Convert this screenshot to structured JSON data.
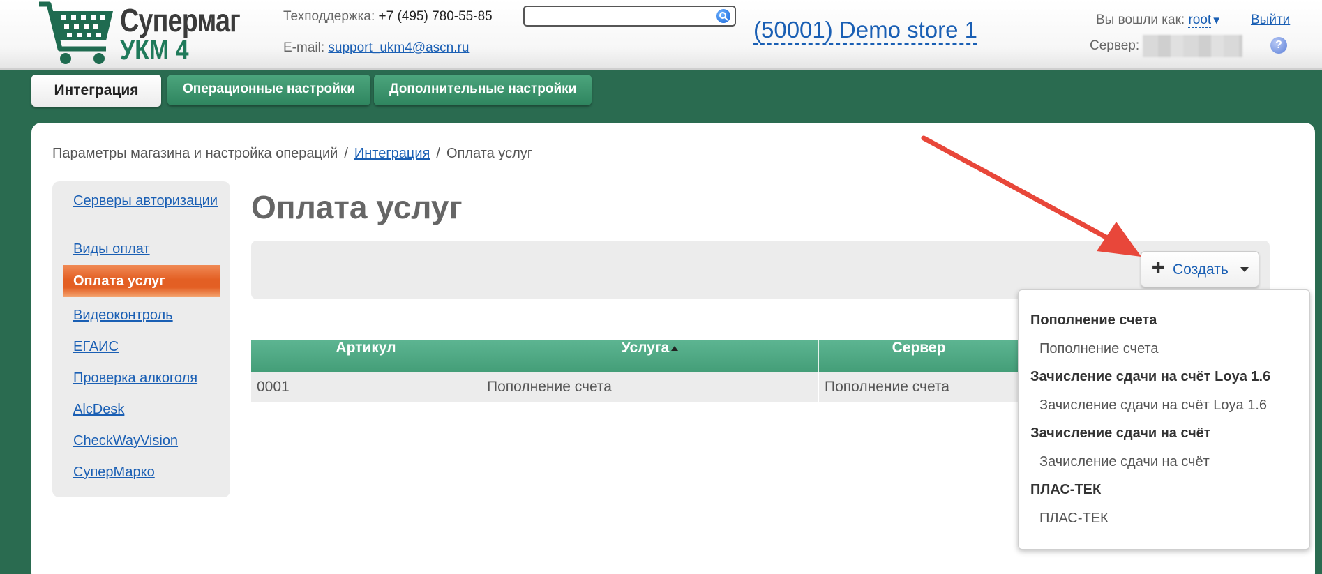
{
  "header": {
    "logo_line1": "Супермаг",
    "logo_line2": "УКМ 4",
    "support_label": "Техподдержка:",
    "support_phone": "+7 (495) 780-55-85",
    "email_label": "E-mail:",
    "email": "support_ukm4@ascn.ru",
    "search": {
      "value": "",
      "placeholder": ""
    },
    "store": "(50001) Demo store 1",
    "login_label": "Вы вошли как:",
    "user": "root",
    "user_caret": "▼",
    "logout": "Выйти",
    "server_label": "Сервер:",
    "help": "?"
  },
  "tabs": [
    {
      "label": "Интеграция",
      "active": true
    },
    {
      "label": "Операционные настройки"
    },
    {
      "label": "Дополнительные настройки"
    }
  ],
  "breadcrumb": {
    "root": "Параметры магазина и настройка операций",
    "parent": "Интеграция",
    "current": "Оплата услуг",
    "separator": "/"
  },
  "sidebar": {
    "items": [
      {
        "label": "Серверы авторизации"
      },
      {
        "label": "Виды оплат"
      },
      {
        "label": "Оплата услуг",
        "active": true
      },
      {
        "label": "Видеоконтроль"
      },
      {
        "label": "ЕГАИС"
      },
      {
        "label": "Проверка алкоголя"
      },
      {
        "label": "AlcDesk"
      },
      {
        "label": "CheckWayVision"
      },
      {
        "label": "СуперМарко"
      }
    ]
  },
  "page": {
    "title": "Оплата услуг",
    "create_button": "Создать",
    "create_icon": "plus-icon"
  },
  "table": {
    "columns": [
      "Артикул",
      "Услуга",
      "Сервер"
    ],
    "sorted_column": "Услуга",
    "sort_direction": "asc",
    "rows": [
      [
        "0001",
        "Пополнение счета",
        "Пополнение счета"
      ]
    ]
  },
  "dropdown": {
    "groups": [
      {
        "title": "Пополнение счета",
        "item": "Пополнение счета"
      },
      {
        "title": "Зачисление сдачи на счёт Loya 1.6",
        "item": "Зачисление сдачи на счёт Loya 1.6"
      },
      {
        "title": "Зачисление сдачи на счёт",
        "item": "Зачисление сдачи на счёт"
      },
      {
        "title": "ПЛАС-ТЕК",
        "item": "ПЛАС-ТЕК"
      }
    ]
  },
  "colors": {
    "background": "#2a6b50",
    "accent": "#1a5fb4",
    "active_nav": "#e35f24",
    "table_header": "#4fa983",
    "annotation_arrow": "#e8473a"
  }
}
